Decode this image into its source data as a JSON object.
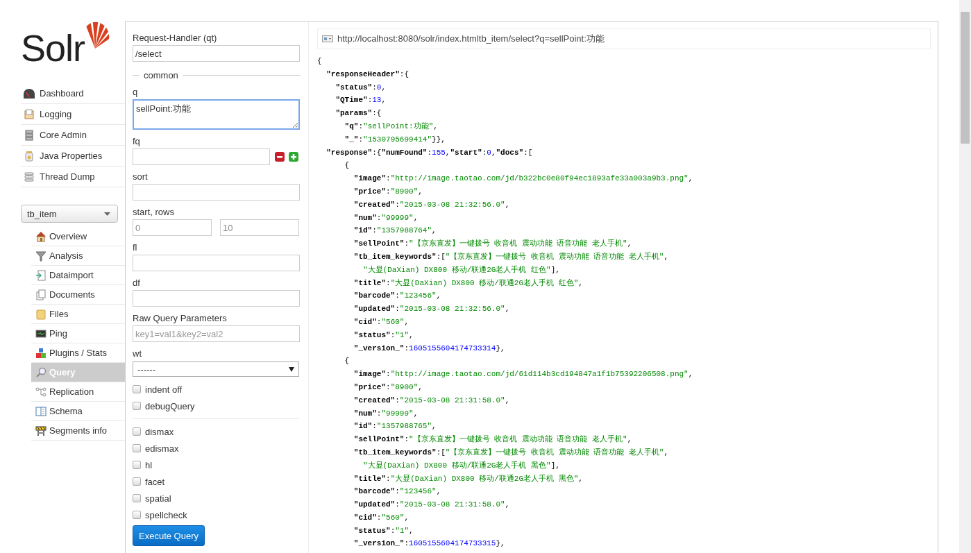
{
  "logo": {
    "text": "Solr"
  },
  "nav": [
    {
      "label": "Dashboard"
    },
    {
      "label": "Logging"
    },
    {
      "label": "Core Admin"
    },
    {
      "label": "Java Properties"
    },
    {
      "label": "Thread Dump"
    }
  ],
  "core_selector": {
    "value": "tb_item"
  },
  "core_nav": [
    {
      "label": "Overview",
      "selected": false
    },
    {
      "label": "Analysis",
      "selected": false
    },
    {
      "label": "Dataimport",
      "selected": false
    },
    {
      "label": "Documents",
      "selected": false
    },
    {
      "label": "Files",
      "selected": false
    },
    {
      "label": "Ping",
      "selected": false
    },
    {
      "label": "Plugins / Stats",
      "selected": false
    },
    {
      "label": "Query",
      "selected": true
    },
    {
      "label": "Replication",
      "selected": false
    },
    {
      "label": "Schema",
      "selected": false
    },
    {
      "label": "Segments info",
      "selected": false
    }
  ],
  "form": {
    "handler": {
      "label": "Request-Handler (qt)",
      "value": "/select"
    },
    "section": "common",
    "q": {
      "label": "q",
      "value": "sellPoint:功能",
      "focused": true
    },
    "fq": {
      "label": "fq"
    },
    "sort": {
      "label": "sort"
    },
    "start_rows": {
      "label": "start, rows",
      "start": "0",
      "rows": "10"
    },
    "fl": {
      "label": "fl"
    },
    "df": {
      "label": "df"
    },
    "raw": {
      "label": "Raw Query Parameters",
      "placeholder": "key1=val1&key2=val2"
    },
    "wt": {
      "label": "wt",
      "value": "------"
    },
    "options": [
      {
        "label": "indent off",
        "checked": false
      },
      {
        "label": "debugQuery",
        "checked": false
      }
    ],
    "parsers": [
      {
        "label": "dismax",
        "checked": false
      },
      {
        "label": "edismax",
        "checked": false
      },
      {
        "label": "hl",
        "checked": false
      },
      {
        "label": "facet",
        "checked": false
      },
      {
        "label": "spatial",
        "checked": false
      },
      {
        "label": "spellcheck",
        "checked": false
      }
    ],
    "button": "Execute Query"
  },
  "result": {
    "url": "http://localhost:8080/solr/index.htmltb_item/select?q=sellPoint:功能",
    "lines": [
      [
        {
          "kind": "punct",
          "text": "{"
        }
      ],
      [
        {
          "kind": "key",
          "text": "  \"responseHeader\""
        },
        {
          "kind": "punct",
          "text": ":{"
        }
      ],
      [
        {
          "kind": "key",
          "text": "    \"status\""
        },
        {
          "kind": "punct",
          "text": ":"
        },
        {
          "kind": "number",
          "text": "0"
        },
        {
          "kind": "punct",
          "text": ","
        }
      ],
      [
        {
          "kind": "key",
          "text": "    \"QTime\""
        },
        {
          "kind": "punct",
          "text": ":"
        },
        {
          "kind": "number",
          "text": "13"
        },
        {
          "kind": "punct",
          "text": ","
        }
      ],
      [
        {
          "kind": "key",
          "text": "    \"params\""
        },
        {
          "kind": "punct",
          "text": ":{"
        }
      ],
      [
        {
          "kind": "key",
          "text": "      \"q\""
        },
        {
          "kind": "punct",
          "text": ":"
        },
        {
          "kind": "string",
          "text": "\"sellPoint:功能\""
        },
        {
          "kind": "punct",
          "text": ","
        }
      ],
      [
        {
          "kind": "key",
          "text": "      \"_\""
        },
        {
          "kind": "punct",
          "text": ":"
        },
        {
          "kind": "string",
          "text": "\"1530795699414\""
        },
        {
          "kind": "punct",
          "text": "}},"
        }
      ],
      [
        {
          "kind": "key",
          "text": "  \"response\""
        },
        {
          "kind": "punct",
          "text": ":{"
        },
        {
          "kind": "key",
          "text": "\"numFound\""
        },
        {
          "kind": "punct",
          "text": ":"
        },
        {
          "kind": "number",
          "text": "155"
        },
        {
          "kind": "punct",
          "text": ","
        },
        {
          "kind": "key",
          "text": "\"start\""
        },
        {
          "kind": "punct",
          "text": ":"
        },
        {
          "kind": "number",
          "text": "0"
        },
        {
          "kind": "punct",
          "text": ","
        },
        {
          "kind": "key",
          "text": "\"docs\""
        },
        {
          "kind": "punct",
          "text": ":["
        }
      ],
      [
        {
          "kind": "punct",
          "text": "      {"
        }
      ],
      [
        {
          "kind": "key",
          "text": "        \"image\""
        },
        {
          "kind": "punct",
          "text": ":"
        },
        {
          "kind": "string",
          "text": "\"http://image.taotao.com/jd/b322bc0e80f94ec1893afe33a003a9b3.png\""
        },
        {
          "kind": "punct",
          "text": ","
        }
      ],
      [
        {
          "kind": "key",
          "text": "        \"price\""
        },
        {
          "kind": "punct",
          "text": ":"
        },
        {
          "kind": "string",
          "text": "\"8900\""
        },
        {
          "kind": "punct",
          "text": ","
        }
      ],
      [
        {
          "kind": "key",
          "text": "        \"created\""
        },
        {
          "kind": "punct",
          "text": ":"
        },
        {
          "kind": "string",
          "text": "\"2015-03-08 21:32:56.0\""
        },
        {
          "kind": "punct",
          "text": ","
        }
      ],
      [
        {
          "kind": "key",
          "text": "        \"num\""
        },
        {
          "kind": "punct",
          "text": ":"
        },
        {
          "kind": "string",
          "text": "\"99999\""
        },
        {
          "kind": "punct",
          "text": ","
        }
      ],
      [
        {
          "kind": "key",
          "text": "        \"id\""
        },
        {
          "kind": "punct",
          "text": ":"
        },
        {
          "kind": "string",
          "text": "\"1357988764\""
        },
        {
          "kind": "punct",
          "text": ","
        }
      ],
      [
        {
          "kind": "key",
          "text": "        \"sellPoint\""
        },
        {
          "kind": "punct",
          "text": ":"
        },
        {
          "kind": "string",
          "text": "\"【京东直发】一键拨号 收音机 震动功能 语音功能 老人手机\""
        },
        {
          "kind": "punct",
          "text": ","
        }
      ],
      [
        {
          "kind": "key",
          "text": "        \"tb_item_keywords\""
        },
        {
          "kind": "punct",
          "text": ":["
        },
        {
          "kind": "string",
          "text": "\"【京东直发】一键拨号 收音机 震动功能 语音功能 老人手机\""
        },
        {
          "kind": "punct",
          "text": ","
        }
      ],
      [
        {
          "kind": "string",
          "text": "          \"大显(DaXian) DX800 移动/联通2G老人手机 红色\""
        },
        {
          "kind": "punct",
          "text": "],"
        }
      ],
      [
        {
          "kind": "key",
          "text": "        \"title\""
        },
        {
          "kind": "punct",
          "text": ":"
        },
        {
          "kind": "string",
          "text": "\"大显(DaXian) DX800 移动/联通2G老人手机 红色\""
        },
        {
          "kind": "punct",
          "text": ","
        }
      ],
      [
        {
          "kind": "key",
          "text": "        \"barcode\""
        },
        {
          "kind": "punct",
          "text": ":"
        },
        {
          "kind": "string",
          "text": "\"123456\""
        },
        {
          "kind": "punct",
          "text": ","
        }
      ],
      [
        {
          "kind": "key",
          "text": "        \"updated\""
        },
        {
          "kind": "punct",
          "text": ":"
        },
        {
          "kind": "string",
          "text": "\"2015-03-08 21:32:56.0\""
        },
        {
          "kind": "punct",
          "text": ","
        }
      ],
      [
        {
          "kind": "key",
          "text": "        \"cid\""
        },
        {
          "kind": "punct",
          "text": ":"
        },
        {
          "kind": "string",
          "text": "\"560\""
        },
        {
          "kind": "punct",
          "text": ","
        }
      ],
      [
        {
          "kind": "key",
          "text": "        \"status\""
        },
        {
          "kind": "punct",
          "text": ":"
        },
        {
          "kind": "string",
          "text": "\"1\""
        },
        {
          "kind": "punct",
          "text": ","
        }
      ],
      [
        {
          "kind": "key",
          "text": "        \"_version_\""
        },
        {
          "kind": "punct",
          "text": ":"
        },
        {
          "kind": "number",
          "text": "1605155604174733314"
        },
        {
          "kind": "punct",
          "text": "},"
        }
      ],
      [
        {
          "kind": "punct",
          "text": "      {"
        }
      ],
      [
        {
          "kind": "key",
          "text": "        \"image\""
        },
        {
          "kind": "punct",
          "text": ":"
        },
        {
          "kind": "string",
          "text": "\"http://image.taotao.com/jd/61d114b3cd194847a1f1b75392206508.png\""
        },
        {
          "kind": "punct",
          "text": ","
        }
      ],
      [
        {
          "kind": "key",
          "text": "        \"price\""
        },
        {
          "kind": "punct",
          "text": ":"
        },
        {
          "kind": "string",
          "text": "\"8900\""
        },
        {
          "kind": "punct",
          "text": ","
        }
      ],
      [
        {
          "kind": "key",
          "text": "        \"created\""
        },
        {
          "kind": "punct",
          "text": ":"
        },
        {
          "kind": "string",
          "text": "\"2015-03-08 21:31:58.0\""
        },
        {
          "kind": "punct",
          "text": ","
        }
      ],
      [
        {
          "kind": "key",
          "text": "        \"num\""
        },
        {
          "kind": "punct",
          "text": ":"
        },
        {
          "kind": "string",
          "text": "\"99999\""
        },
        {
          "kind": "punct",
          "text": ","
        }
      ],
      [
        {
          "kind": "key",
          "text": "        \"id\""
        },
        {
          "kind": "punct",
          "text": ":"
        },
        {
          "kind": "string",
          "text": "\"1357988765\""
        },
        {
          "kind": "punct",
          "text": ","
        }
      ],
      [
        {
          "kind": "key",
          "text": "        \"sellPoint\""
        },
        {
          "kind": "punct",
          "text": ":"
        },
        {
          "kind": "string",
          "text": "\"【京东直发】一键拨号 收音机 震动功能 语音功能 老人手机\""
        },
        {
          "kind": "punct",
          "text": ","
        }
      ],
      [
        {
          "kind": "key",
          "text": "        \"tb_item_keywords\""
        },
        {
          "kind": "punct",
          "text": ":["
        },
        {
          "kind": "string",
          "text": "\"【京东直发】一键拨号 收音机 震动功能 语音功能 老人手机\""
        },
        {
          "kind": "punct",
          "text": ","
        }
      ],
      [
        {
          "kind": "string",
          "text": "          \"大显(DaXian) DX800 移动/联通2G老人手机 黑色\""
        },
        {
          "kind": "punct",
          "text": "],"
        }
      ],
      [
        {
          "kind": "key",
          "text": "        \"title\""
        },
        {
          "kind": "punct",
          "text": ":"
        },
        {
          "kind": "string",
          "text": "\"大显(DaXian) DX800 移动/联通2G老人手机 黑色\""
        },
        {
          "kind": "punct",
          "text": ","
        }
      ],
      [
        {
          "kind": "key",
          "text": "        \"barcode\""
        },
        {
          "kind": "punct",
          "text": ":"
        },
        {
          "kind": "string",
          "text": "\"123456\""
        },
        {
          "kind": "punct",
          "text": ","
        }
      ],
      [
        {
          "kind": "key",
          "text": "        \"updated\""
        },
        {
          "kind": "punct",
          "text": ":"
        },
        {
          "kind": "string",
          "text": "\"2015-03-08 21:31:58.0\""
        },
        {
          "kind": "punct",
          "text": ","
        }
      ],
      [
        {
          "kind": "key",
          "text": "        \"cid\""
        },
        {
          "kind": "punct",
          "text": ":"
        },
        {
          "kind": "string",
          "text": "\"560\""
        },
        {
          "kind": "punct",
          "text": ","
        }
      ],
      [
        {
          "kind": "key",
          "text": "        \"status\""
        },
        {
          "kind": "punct",
          "text": ":"
        },
        {
          "kind": "string",
          "text": "\"1\""
        },
        {
          "kind": "punct",
          "text": ","
        }
      ],
      [
        {
          "kind": "key",
          "text": "        \"_version_\""
        },
        {
          "kind": "punct",
          "text": ":"
        },
        {
          "kind": "number",
          "text": "1605155604174733315"
        },
        {
          "kind": "punct",
          "text": "},"
        }
      ]
    ]
  }
}
